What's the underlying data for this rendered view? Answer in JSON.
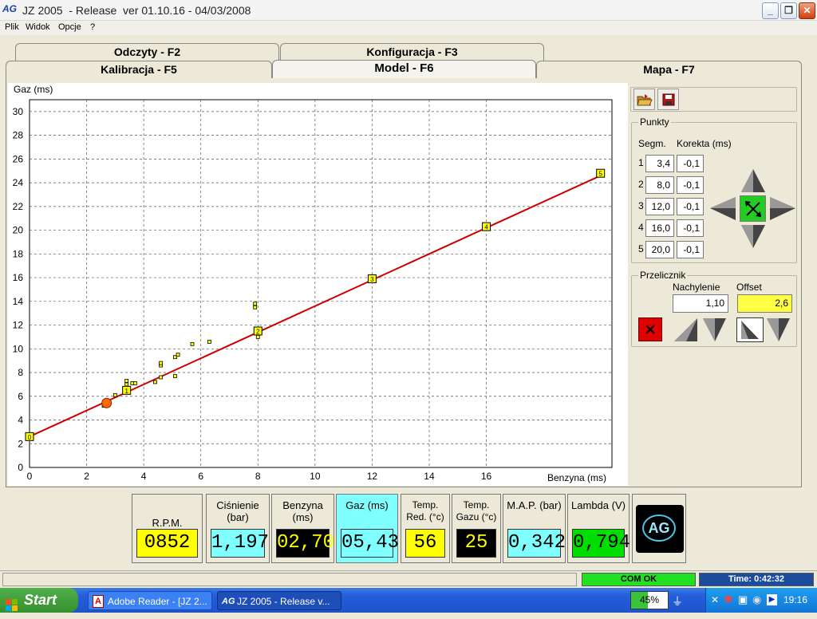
{
  "window": {
    "logo": "AG",
    "title": "JZ 2005  - Release  ver 01.10.16 - 04/03/2008",
    "minimize_glyph": "_",
    "restore_glyph": "❐",
    "close_glyph": "✕"
  },
  "menu": [
    "Plik",
    "Widok",
    "Opcje",
    "?"
  ],
  "tabs": {
    "row1": [
      "Odczyty - F2",
      "Konfiguracja - F3"
    ],
    "row2": [
      "Kalibracja - F5",
      "Model - F6",
      "Mapa - F7"
    ],
    "active": "Model - F6"
  },
  "chart_data": {
    "type": "scatter",
    "xlabel": "Benzyna (ms)",
    "ylabel": "Gaz (ms)",
    "xlim": [
      0,
      20.4
    ],
    "ylim": [
      0,
      31
    ],
    "xticks": [
      0,
      2,
      4,
      6,
      8,
      10,
      12,
      14,
      16
    ],
    "yticks": [
      0,
      2,
      4,
      6,
      8,
      10,
      12,
      14,
      16,
      18,
      20,
      22,
      24,
      26,
      28,
      30
    ],
    "grid": true,
    "line": {
      "color": "#CC0000",
      "x": [
        0,
        20.0
      ],
      "y": [
        2.6,
        24.6
      ]
    },
    "control_points": [
      {
        "label": "0",
        "x": 0,
        "y": 2.6
      },
      {
        "label": "1",
        "x": 3.4,
        "y": 6.5
      },
      {
        "label": "2",
        "x": 8.0,
        "y": 11.5
      },
      {
        "label": "3",
        "x": 12.0,
        "y": 15.9
      },
      {
        "label": "4",
        "x": 16.0,
        "y": 20.3
      },
      {
        "label": "5",
        "x": 20.0,
        "y": 24.8
      }
    ],
    "samples": [
      {
        "x": 2.6,
        "y": 5.2
      },
      {
        "x": 2.7,
        "y": 5.6
      },
      {
        "x": 3.0,
        "y": 6.1
      },
      {
        "x": 3.4,
        "y": 7.0
      },
      {
        "x": 3.4,
        "y": 7.3
      },
      {
        "x": 3.6,
        "y": 7.1
      },
      {
        "x": 3.7,
        "y": 7.1
      },
      {
        "x": 4.4,
        "y": 7.2
      },
      {
        "x": 4.6,
        "y": 7.6
      },
      {
        "x": 4.6,
        "y": 8.6
      },
      {
        "x": 4.6,
        "y": 8.8
      },
      {
        "x": 5.1,
        "y": 7.7
      },
      {
        "x": 5.1,
        "y": 9.3
      },
      {
        "x": 5.2,
        "y": 9.5
      },
      {
        "x": 5.7,
        "y": 10.4
      },
      {
        "x": 6.3,
        "y": 10.6
      },
      {
        "x": 7.9,
        "y": 13.5
      },
      {
        "x": 7.9,
        "y": 13.8
      },
      {
        "x": 8.0,
        "y": 11.0
      }
    ],
    "current_point": {
      "x": 2.7,
      "y": 5.43
    }
  },
  "points": {
    "title": "Punkty",
    "col_segm": "Segm.",
    "col_korekta": "Korekta (ms)",
    "rows": [
      {
        "n": "1",
        "segm": "3,4",
        "korekta": "-0,1"
      },
      {
        "n": "2",
        "segm": "8,0",
        "korekta": "-0,1"
      },
      {
        "n": "3",
        "segm": "12,0",
        "korekta": "-0,1"
      },
      {
        "n": "4",
        "segm": "16,0",
        "korekta": "-0,1"
      },
      {
        "n": "5",
        "segm": "20,0",
        "korekta": "-0,1"
      }
    ]
  },
  "przelicznik": {
    "title": "Przelicznik",
    "nachylenie_label": "Nachylenie",
    "nachylenie": "1,10",
    "offset_label": "Offset",
    "offset": "2,6"
  },
  "gauges": [
    {
      "title": "R.P.M.",
      "value": "0852",
      "bg": "#FFFF00",
      "fg": "#000000",
      "panel": "#ECE9D8"
    },
    {
      "title": "Ciśnienie (bar)",
      "value": "1,197",
      "bg": "#80FFFF",
      "fg": "#000000",
      "panel": "#ECE9D8"
    },
    {
      "title": "Benzyna (ms)",
      "value": "02,70",
      "bg": "#000000",
      "fg": "#FFFF00",
      "panel": "#ECE9D8"
    },
    {
      "title": "Gaz (ms)",
      "value": "05,43",
      "bg": "#80FFFF",
      "fg": "#000000",
      "panel": "#80FFFF"
    },
    {
      "title": "Temp. Red. (°c)",
      "value": "56",
      "bg": "#FFFF00",
      "fg": "#000000",
      "panel": "#ECE9D8"
    },
    {
      "title": "Temp. Gazu (°c)",
      "value": "25",
      "bg": "#000000",
      "fg": "#FFFF00",
      "panel": "#ECE9D8"
    },
    {
      "title": "M.A.P. (bar)",
      "value": "0,342",
      "bg": "#80FFFF",
      "fg": "#000000",
      "panel": "#ECE9D8"
    },
    {
      "title": "Lambda (V)",
      "value": "0,794",
      "bg": "#00DD00",
      "fg": "#000000",
      "panel": "#ECE9D8"
    }
  ],
  "brand_logo": "AG",
  "status": {
    "com": "COM OK",
    "time": "Time: 0:42:32"
  },
  "taskbar": {
    "start": "Start",
    "tasks": [
      "Adobe Reader - [JZ 2...",
      "JZ 2005 - Release  v..."
    ],
    "battery": "45%",
    "clock": "19:16"
  }
}
